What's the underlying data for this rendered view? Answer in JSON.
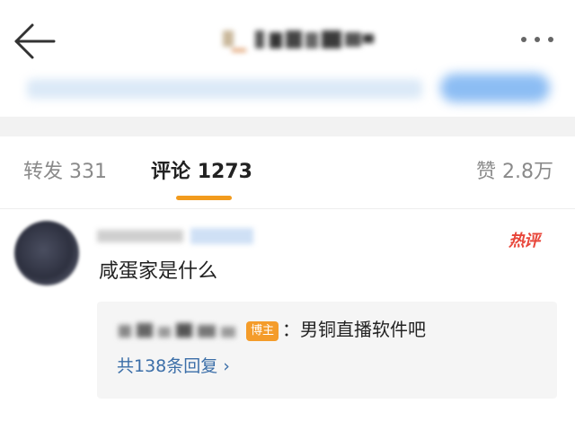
{
  "header": {
    "back_icon": "arrow-left-icon",
    "more_icon": "more-dots-icon"
  },
  "tabs": [
    {
      "label": "转发",
      "count": "331",
      "active": false
    },
    {
      "label": "评论",
      "count": "1273",
      "active": true
    },
    {
      "label": "赞",
      "count": "2.8万",
      "active": false
    }
  ],
  "comment": {
    "badge": "热评",
    "text": "咸蛋家是什么",
    "reply": {
      "author_badge": "博主",
      "text": "：男铜直播软件吧",
      "more_label": "共138条回复 ›"
    }
  },
  "colors": {
    "accent_tab_indicator": "#f29b1d",
    "hot_badge": "#e8463a",
    "host_badge": "#f49c2a",
    "link": "#3b6ea8"
  }
}
